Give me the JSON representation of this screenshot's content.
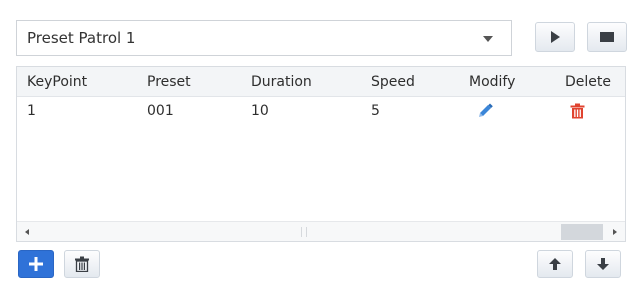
{
  "patrol": {
    "selected": "Preset Patrol 1"
  },
  "table": {
    "headers": [
      "KeyPoint",
      "Preset",
      "Duration",
      "Speed",
      "Modify",
      "Delete"
    ],
    "rows": [
      {
        "keypoint": "1",
        "preset": "001",
        "duration": "10",
        "speed": "5",
        "modify_icon": "pencil-icon",
        "delete_icon": "trash-icon"
      }
    ]
  },
  "icons": {
    "play": "play-icon",
    "stop": "stop-icon",
    "add": "plus-icon",
    "delete": "trash-icon",
    "up": "arrow-up-icon",
    "down": "arrow-down-icon"
  },
  "colors": {
    "accent": "#2f72d8",
    "delete_red": "#e0432f",
    "edit_blue": "#3b86d8"
  }
}
